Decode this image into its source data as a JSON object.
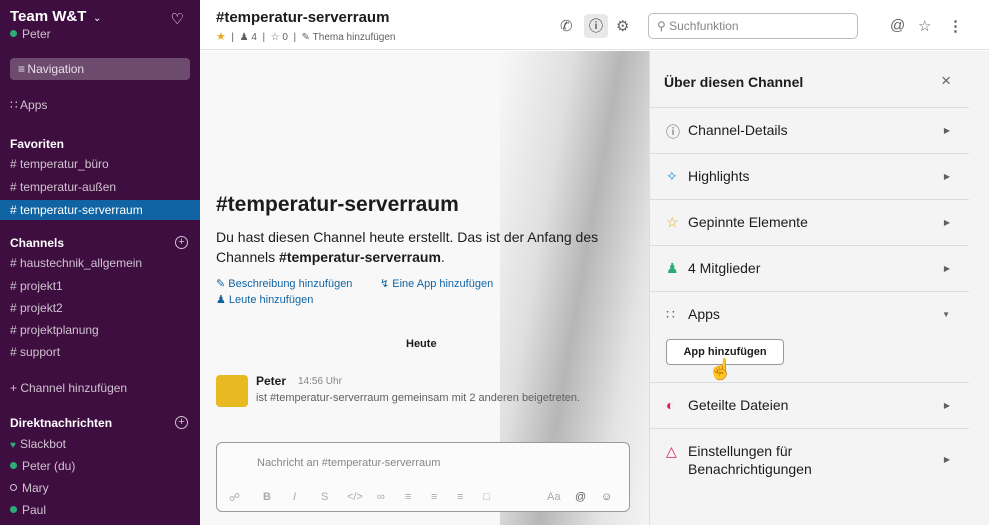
{
  "workspace": {
    "name": "Team W&T",
    "user": "Peter",
    "navigation": "Navigation",
    "apps": "Apps"
  },
  "sidebar": {
    "favorites_heading": "Favoriten",
    "favorites": [
      "# temperatur_büro",
      "# temperatur-außen",
      "# temperatur-serverraum"
    ],
    "channels_heading": "Channels",
    "channels": [
      "# haustechnik_allgemein",
      "# projekt1",
      "# projekt2",
      "# projektplanung",
      "# support"
    ],
    "add_channel": "+ Channel hinzufügen",
    "dm_heading": "Direktnachrichten",
    "dms": [
      "Slackbot",
      "Peter  (du)",
      "Mary",
      "Paul"
    ]
  },
  "header": {
    "channel": "#temperatur-serverraum",
    "members": "4",
    "pinned": "0",
    "add_topic": "Thema hinzufügen",
    "search_placeholder": "Suchfunktion"
  },
  "main": {
    "welcome_title": "#temperatur-serverraum",
    "welcome_pre": "Du hast diesen Channel heute erstellt. Das ist der Anfang des Channels ",
    "welcome_channel": "#temperatur-serverraum",
    "welcome_post": ".",
    "add_description": "Beschreibung hinzufügen",
    "add_app": "Eine App hinzufügen",
    "add_people": "Leute hinzufügen",
    "today": "Heute",
    "message": {
      "author": "Peter",
      "time": "14:56 Uhr",
      "text": "ist #temperatur-serverraum gemeinsam mit 2 anderen beigetreten."
    },
    "composer_placeholder": "Nachricht an #temperatur-serverraum"
  },
  "panel": {
    "title": "Über diesen Channel",
    "sections": {
      "details": "Channel-Details",
      "highlights": "Highlights",
      "pinned": "Gepinnte Elemente",
      "members": "4 Mitglieder",
      "apps": "Apps",
      "files": "Geteilte Dateien",
      "notifications": "Einstellungen für Benachrichtigungen"
    },
    "add_app_button": "App hinzufügen"
  },
  "colors": {
    "sidebar_bg": "#3f0e40",
    "active_item": "#1164a3",
    "link": "#1264a3",
    "presence_green": "#2bac76",
    "star": "#e8a723",
    "avatar": "#e8b923"
  }
}
